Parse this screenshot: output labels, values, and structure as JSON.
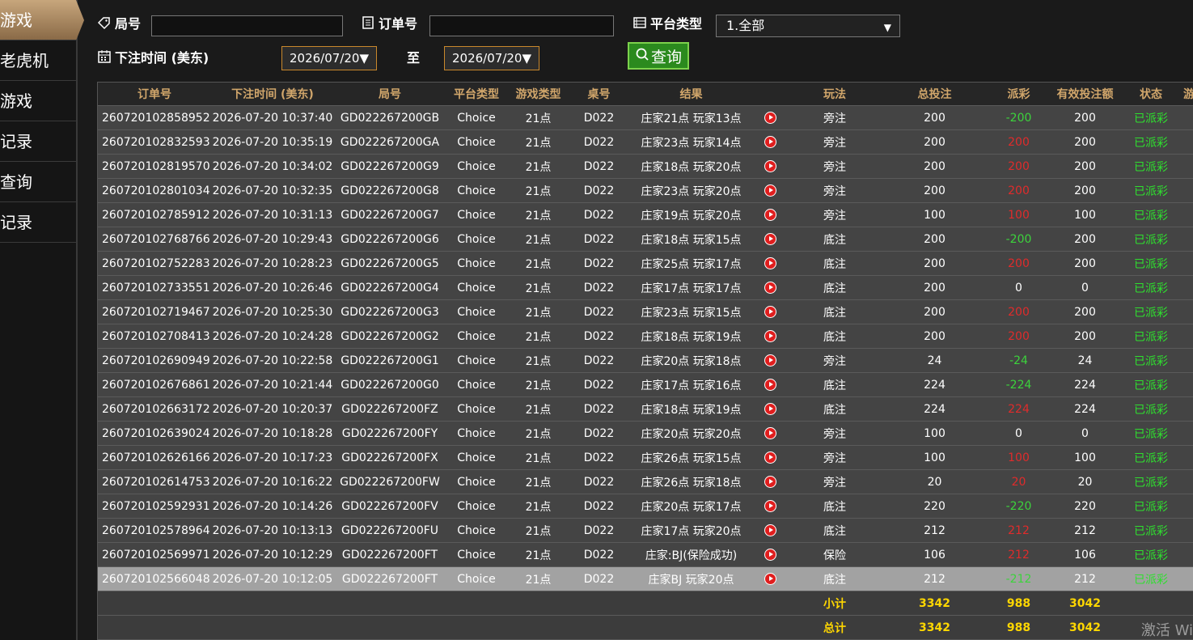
{
  "sidebar": {
    "items": [
      {
        "label": "游戏",
        "active": true
      },
      {
        "label": "老虎机",
        "active": false
      },
      {
        "label": "游戏",
        "active": false
      },
      {
        "label": "记录",
        "active": false
      },
      {
        "label": "查询",
        "active": false
      },
      {
        "label": "记录",
        "active": false
      }
    ]
  },
  "filters": {
    "round_label": "局号",
    "round_value": "",
    "order_label": "订单号",
    "order_value": "",
    "platform_label": "平台类型",
    "platform_selected": "1.全部",
    "bet_time_label": "下注时间 (美东)",
    "date_from": "2026/07/20▼",
    "to_label": "至",
    "date_to": "2026/07/20▼",
    "query_label": "查询"
  },
  "colors": {
    "header_gold": "#d1a66b",
    "win_green": "#3cd33c",
    "loss_red": "#e02b2b",
    "status_green": "#2ee02e",
    "query_green": "#2b8a1e"
  },
  "table": {
    "columns": [
      "订单号",
      "下注时间 (美东)",
      "局号",
      "平台类型",
      "游戏类型",
      "桌号",
      "结果",
      "",
      "玩法",
      "总投注",
      "派彩",
      "有效投注额",
      "状态",
      "游戏"
    ],
    "rows": [
      {
        "order": "260720102858952",
        "time": "2026-07-20 10:37:40",
        "round": "GD022267200GB",
        "platform": "Choice",
        "game": "21点",
        "table": "D022",
        "result": "庄家21点 玩家13点",
        "play": "旁注",
        "bet": "200",
        "payout": "-200",
        "payout_type": "neg",
        "valid": "200",
        "status": "已派彩"
      },
      {
        "order": "260720102832593",
        "time": "2026-07-20 10:35:19",
        "round": "GD022267200GA",
        "platform": "Choice",
        "game": "21点",
        "table": "D022",
        "result": "庄家23点 玩家14点",
        "play": "旁注",
        "bet": "200",
        "payout": "200",
        "payout_type": "pos",
        "valid": "200",
        "status": "已派彩"
      },
      {
        "order": "260720102819570",
        "time": "2026-07-20 10:34:02",
        "round": "GD022267200G9",
        "platform": "Choice",
        "game": "21点",
        "table": "D022",
        "result": "庄家18点 玩家20点",
        "play": "旁注",
        "bet": "200",
        "payout": "200",
        "payout_type": "pos",
        "valid": "200",
        "status": "已派彩"
      },
      {
        "order": "260720102801034",
        "time": "2026-07-20 10:32:35",
        "round": "GD022267200G8",
        "platform": "Choice",
        "game": "21点",
        "table": "D022",
        "result": "庄家23点 玩家20点",
        "play": "旁注",
        "bet": "200",
        "payout": "200",
        "payout_type": "pos",
        "valid": "200",
        "status": "已派彩"
      },
      {
        "order": "260720102785912",
        "time": "2026-07-20 10:31:13",
        "round": "GD022267200G7",
        "platform": "Choice",
        "game": "21点",
        "table": "D022",
        "result": "庄家19点 玩家20点",
        "play": "旁注",
        "bet": "100",
        "payout": "100",
        "payout_type": "pos",
        "valid": "100",
        "status": "已派彩"
      },
      {
        "order": "260720102768766",
        "time": "2026-07-20 10:29:43",
        "round": "GD022267200G6",
        "platform": "Choice",
        "game": "21点",
        "table": "D022",
        "result": "庄家18点 玩家15点",
        "play": "底注",
        "bet": "200",
        "payout": "-200",
        "payout_type": "neg",
        "valid": "200",
        "status": "已派彩"
      },
      {
        "order": "260720102752283",
        "time": "2026-07-20 10:28:23",
        "round": "GD022267200G5",
        "platform": "Choice",
        "game": "21点",
        "table": "D022",
        "result": "庄家25点 玩家17点",
        "play": "底注",
        "bet": "200",
        "payout": "200",
        "payout_type": "pos",
        "valid": "200",
        "status": "已派彩"
      },
      {
        "order": "260720102733551",
        "time": "2026-07-20 10:26:46",
        "round": "GD022267200G4",
        "platform": "Choice",
        "game": "21点",
        "table": "D022",
        "result": "庄家17点 玩家17点",
        "play": "底注",
        "bet": "200",
        "payout": "0",
        "payout_type": "zero",
        "valid": "0",
        "status": "已派彩"
      },
      {
        "order": "260720102719467",
        "time": "2026-07-20 10:25:30",
        "round": "GD022267200G3",
        "platform": "Choice",
        "game": "21点",
        "table": "D022",
        "result": "庄家23点 玩家15点",
        "play": "底注",
        "bet": "200",
        "payout": "200",
        "payout_type": "pos",
        "valid": "200",
        "status": "已派彩"
      },
      {
        "order": "260720102708413",
        "time": "2026-07-20 10:24:28",
        "round": "GD022267200G2",
        "platform": "Choice",
        "game": "21点",
        "table": "D022",
        "result": "庄家18点 玩家19点",
        "play": "底注",
        "bet": "200",
        "payout": "200",
        "payout_type": "pos",
        "valid": "200",
        "status": "已派彩"
      },
      {
        "order": "260720102690949",
        "time": "2026-07-20 10:22:58",
        "round": "GD022267200G1",
        "platform": "Choice",
        "game": "21点",
        "table": "D022",
        "result": "庄家20点 玩家18点",
        "play": "旁注",
        "bet": "24",
        "payout": "-24",
        "payout_type": "neg",
        "valid": "24",
        "status": "已派彩"
      },
      {
        "order": "260720102676861",
        "time": "2026-07-20 10:21:44",
        "round": "GD022267200G0",
        "platform": "Choice",
        "game": "21点",
        "table": "D022",
        "result": "庄家17点 玩家16点",
        "play": "底注",
        "bet": "224",
        "payout": "-224",
        "payout_type": "neg",
        "valid": "224",
        "status": "已派彩"
      },
      {
        "order": "260720102663172",
        "time": "2026-07-20 10:20:37",
        "round": "GD022267200FZ",
        "platform": "Choice",
        "game": "21点",
        "table": "D022",
        "result": "庄家18点 玩家19点",
        "play": "底注",
        "bet": "224",
        "payout": "224",
        "payout_type": "pos",
        "valid": "224",
        "status": "已派彩"
      },
      {
        "order": "260720102639024",
        "time": "2026-07-20 10:18:28",
        "round": "GD022267200FY",
        "platform": "Choice",
        "game": "21点",
        "table": "D022",
        "result": "庄家20点 玩家20点",
        "play": "旁注",
        "bet": "100",
        "payout": "0",
        "payout_type": "zero",
        "valid": "0",
        "status": "已派彩"
      },
      {
        "order": "260720102626166",
        "time": "2026-07-20 10:17:23",
        "round": "GD022267200FX",
        "platform": "Choice",
        "game": "21点",
        "table": "D022",
        "result": "庄家26点 玩家15点",
        "play": "旁注",
        "bet": "100",
        "payout": "100",
        "payout_type": "pos",
        "valid": "100",
        "status": "已派彩"
      },
      {
        "order": "260720102614753",
        "time": "2026-07-20 10:16:22",
        "round": "GD022267200FW",
        "platform": "Choice",
        "game": "21点",
        "table": "D022",
        "result": "庄家26点 玩家18点",
        "play": "旁注",
        "bet": "20",
        "payout": "20",
        "payout_type": "pos",
        "valid": "20",
        "status": "已派彩"
      },
      {
        "order": "260720102592931",
        "time": "2026-07-20 10:14:26",
        "round": "GD022267200FV",
        "platform": "Choice",
        "game": "21点",
        "table": "D022",
        "result": "庄家20点 玩家17点",
        "play": "底注",
        "bet": "220",
        "payout": "-220",
        "payout_type": "neg",
        "valid": "220",
        "status": "已派彩"
      },
      {
        "order": "260720102578964",
        "time": "2026-07-20 10:13:13",
        "round": "GD022267200FU",
        "platform": "Choice",
        "game": "21点",
        "table": "D022",
        "result": "庄家17点 玩家20点",
        "play": "底注",
        "bet": "212",
        "payout": "212",
        "payout_type": "pos",
        "valid": "212",
        "status": "已派彩"
      },
      {
        "order": "260720102569971",
        "time": "2026-07-20 10:12:29",
        "round": "GD022267200FT",
        "platform": "Choice",
        "game": "21点",
        "table": "D022",
        "result": "庄家:BJ(保险成功)",
        "play": "保险",
        "bet": "106",
        "payout": "212",
        "payout_type": "pos",
        "valid": "106",
        "status": "已派彩"
      },
      {
        "order": "260720102566048",
        "time": "2026-07-20 10:12:05",
        "round": "GD022267200FT",
        "platform": "Choice",
        "game": "21点",
        "table": "D022",
        "result": "庄家BJ 玩家20点",
        "play": "底注",
        "bet": "212",
        "payout": "-212",
        "payout_type": "neg",
        "valid": "212",
        "status": "已派彩",
        "selected": true
      }
    ],
    "subtotal": {
      "label": "小计",
      "bet": "3342",
      "payout": "988",
      "valid": "3042"
    },
    "total": {
      "label": "总计",
      "bet": "3342",
      "payout": "988",
      "valid": "3042"
    }
  },
  "watermark": "激活 Wi"
}
